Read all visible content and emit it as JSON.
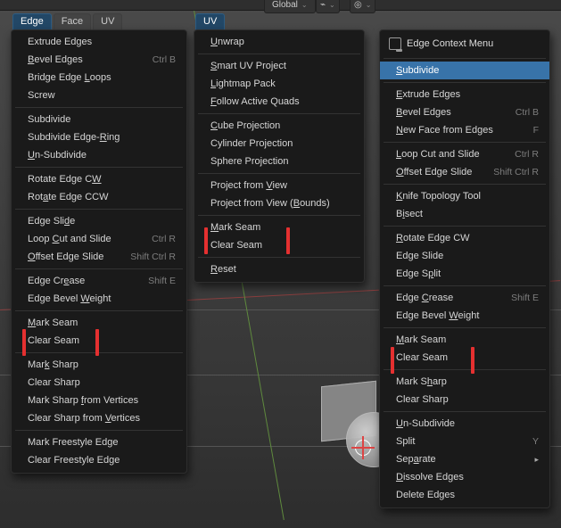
{
  "topbar": {
    "global_dropdown": "Global",
    "snap_icon": "snap-icon",
    "magnet_icon": "magnet-icon"
  },
  "tabs_left": {
    "edge": "Edge",
    "face": "Face",
    "uv": "UV"
  },
  "tabs_center": {
    "uv": "UV"
  },
  "edge_menu": {
    "extrude_edges": "Extrude Edges",
    "bevel_edges": "Bevel Edges",
    "bevel_edges_sc": "Ctrl B",
    "bridge_edge_loops": "Bridge Edge Loops",
    "screw": "Screw",
    "subdivide": "Subdivide",
    "subdivide_edge_ring": "Subdivide Edge-Ring",
    "un_subdivide": "Un-Subdivide",
    "rotate_edge_cw": "Rotate Edge CW",
    "rotate_edge_ccw": "Rotate Edge CCW",
    "edge_slide": "Edge Slide",
    "loop_cut_and_slide": "Loop Cut and Slide",
    "loop_cut_and_slide_sc": "Ctrl R",
    "offset_edge_slide": "Offset Edge Slide",
    "offset_edge_slide_sc": "Shift Ctrl R",
    "edge_crease": "Edge Crease",
    "edge_crease_sc": "Shift E",
    "edge_bevel_weight": "Edge Bevel Weight",
    "mark_seam": "Mark Seam",
    "clear_seam": "Clear Seam",
    "mark_sharp": "Mark Sharp",
    "clear_sharp": "Clear Sharp",
    "mark_sharp_from_vertices": "Mark Sharp from Vertices",
    "clear_sharp_from_vertices": "Clear Sharp from Vertices",
    "mark_freestyle_edge": "Mark Freestyle Edge",
    "clear_freestyle_edge": "Clear Freestyle Edge"
  },
  "uv_menu": {
    "unwrap": "Unwrap",
    "smart_uv_project": "Smart UV Project",
    "lightmap_pack": "Lightmap Pack",
    "follow_active_quads": "Follow Active Quads",
    "cube_projection": "Cube Projection",
    "cylinder_projection": "Cylinder Projection",
    "sphere_projection": "Sphere Projection",
    "project_from_view": "Project from View",
    "project_from_view_bounds": "Project from View (Bounds)",
    "mark_seam": "Mark Seam",
    "clear_seam": "Clear Seam",
    "reset": "Reset"
  },
  "context_menu": {
    "title": "Edge Context Menu",
    "subdivide": "Subdivide",
    "extrude_edges": "Extrude Edges",
    "bevel_edges": "Bevel Edges",
    "bevel_edges_sc": "Ctrl B",
    "new_face_from_edges": "New Face from Edges",
    "new_face_sc": "F",
    "loop_cut_and_slide": "Loop Cut and Slide",
    "loop_cut_sc": "Ctrl R",
    "offset_edge_slide": "Offset Edge Slide",
    "offset_sc": "Shift Ctrl R",
    "knife_topology_tool": "Knife Topology Tool",
    "bisect": "Bisect",
    "rotate_edge_cw": "Rotate Edge CW",
    "edge_slide": "Edge Slide",
    "edge_split": "Edge Split",
    "edge_crease": "Edge Crease",
    "edge_crease_sc": "Shift E",
    "edge_bevel_weight": "Edge Bevel Weight",
    "mark_seam": "Mark Seam",
    "clear_seam": "Clear Seam",
    "mark_sharp": "Mark Sharp",
    "clear_sharp": "Clear Sharp",
    "un_subdivide": "Un-Subdivide",
    "split": "Split",
    "split_sc": "Y",
    "separate": "Separate",
    "dissolve_edges": "Dissolve Edges",
    "delete_edges": "Delete Edges"
  }
}
